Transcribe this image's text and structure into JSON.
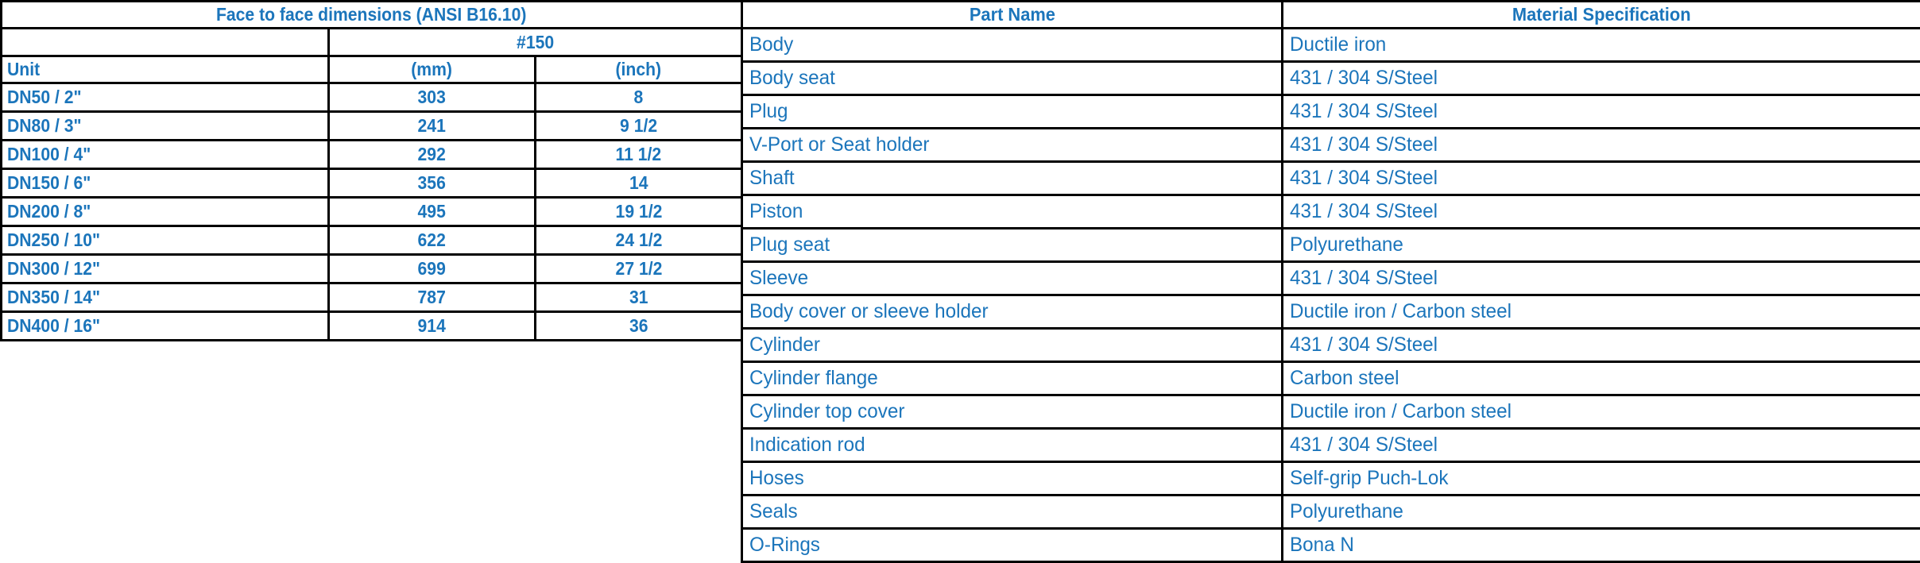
{
  "dimensions_table": {
    "title": "Face to face dimensions (ANSI B16.10)",
    "pressure_class": "#150",
    "unit_label": "Unit",
    "unit_mm": "(mm)",
    "unit_inch": "(inch)",
    "columns": [
      "Unit",
      "(mm)",
      "(inch)"
    ],
    "rows": [
      {
        "size": "DN50 / 2\"",
        "mm": "303",
        "inch": "8"
      },
      {
        "size": "DN80 / 3\"",
        "mm": "241",
        "inch": "9 1/2"
      },
      {
        "size": "DN100 / 4\"",
        "mm": "292",
        "inch": "11 1/2"
      },
      {
        "size": "DN150 / 6\"",
        "mm": "356",
        "inch": "14"
      },
      {
        "size": "DN200 / 8\"",
        "mm": "495",
        "inch": "19 1/2"
      },
      {
        "size": "DN250 / 10\"",
        "mm": "622",
        "inch": "24 1/2"
      },
      {
        "size": "DN300 / 12\"",
        "mm": "699",
        "inch": "27 1/2"
      },
      {
        "size": "DN350 / 14\"",
        "mm": "787",
        "inch": "31"
      },
      {
        "size": "DN400 / 16\"",
        "mm": "914",
        "inch": "36"
      }
    ]
  },
  "parts_table": {
    "header_part": "Part Name",
    "header_material": "Material Specification",
    "rows": [
      {
        "part": "Body",
        "material": "Ductile iron"
      },
      {
        "part": "Body seat",
        "material": "431 / 304 S/Steel"
      },
      {
        "part": "Plug",
        "material": "431 / 304 S/Steel"
      },
      {
        "part": "V-Port or Seat holder",
        "material": "431 / 304 S/Steel"
      },
      {
        "part": "Shaft",
        "material": "431 / 304 S/Steel"
      },
      {
        "part": "Piston",
        "material": "431 / 304 S/Steel"
      },
      {
        "part": "Plug seat",
        "material": "Polyurethane"
      },
      {
        "part": "Sleeve",
        "material": "431 / 304 S/Steel"
      },
      {
        "part": "Body cover or sleeve holder",
        "material": "Ductile iron / Carbon steel"
      },
      {
        "part": "Cylinder",
        "material": "431 / 304 S/Steel"
      },
      {
        "part": "Cylinder flange",
        "material": "Carbon steel"
      },
      {
        "part": "Cylinder top cover",
        "material": "Ductile iron / Carbon steel"
      },
      {
        "part": "Indication rod",
        "material": "431 / 304 S/Steel"
      },
      {
        "part": "Hoses",
        "material": "Self-grip Puch-Lok"
      },
      {
        "part": "Seals",
        "material": "Polyurethane"
      },
      {
        "part": "O-Rings",
        "material": "Bona N"
      }
    ]
  },
  "colors": {
    "text_blue": "#1b75bb",
    "header_fill": "#f2f2f2",
    "cell_fill": "#ffffff",
    "border": "#000000"
  }
}
